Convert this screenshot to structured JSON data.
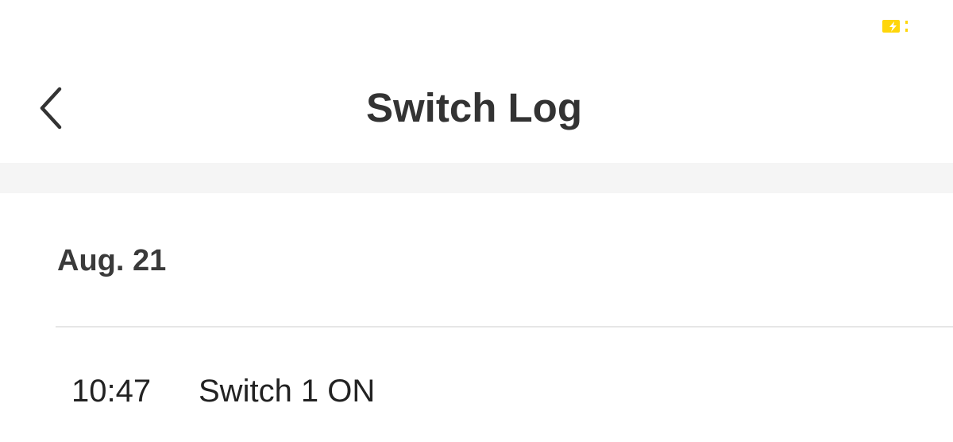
{
  "status_bar": {
    "battery_icon": "battery-charging-icon",
    "battery_color": "#ffd60a"
  },
  "nav": {
    "back_icon": "chevron-left-icon",
    "title": "Switch Log"
  },
  "log": {
    "groups": [
      {
        "date": "Aug. 21",
        "entries": [
          {
            "time": "10:47",
            "event": "Switch 1 ON"
          }
        ]
      }
    ]
  },
  "colors": {
    "background": "#ffffff",
    "section_gap": "#f5f5f5",
    "divider": "#e6e6e6",
    "text": "#333333"
  }
}
